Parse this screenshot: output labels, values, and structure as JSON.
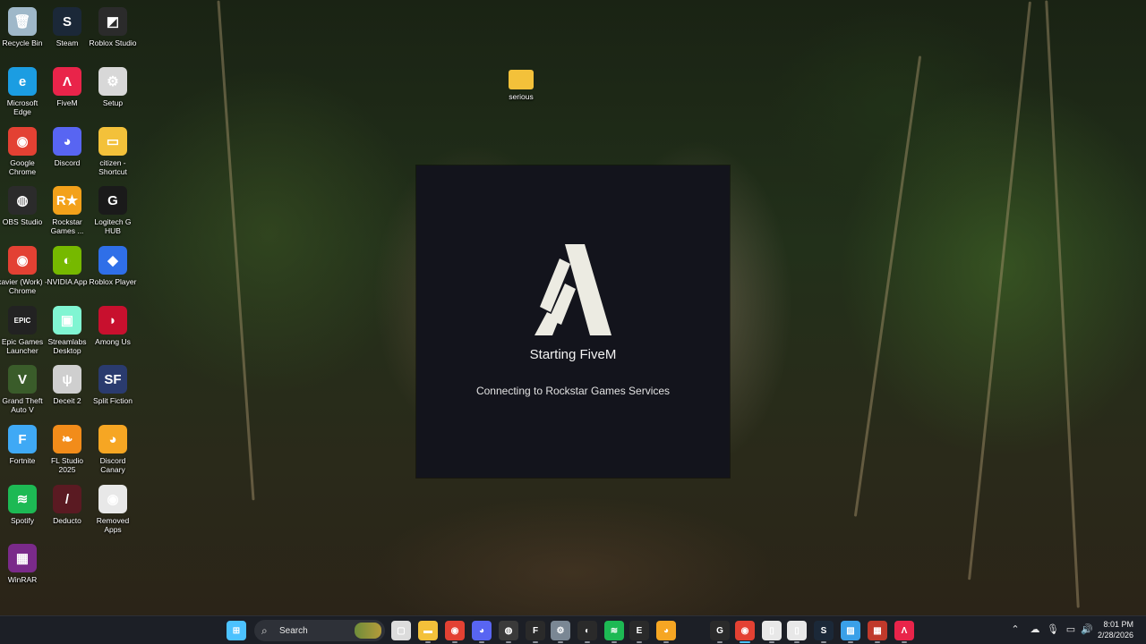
{
  "desktop_icons": [
    {
      "label": "Recycle Bin",
      "icon": "recycle-bin-icon",
      "color": "#9fb8c9",
      "glyph": "🗑",
      "shortcut": false
    },
    {
      "label": "Steam",
      "icon": "steam-icon",
      "color": "#1b2838",
      "glyph": "S",
      "shortcut": true
    },
    {
      "label": "Roblox Studio",
      "icon": "roblox-studio-icon",
      "color": "#2b2b2b",
      "glyph": "◩",
      "shortcut": true
    },
    {
      "label": "Microsoft Edge",
      "icon": "edge-icon",
      "color": "#1b9de2",
      "glyph": "e",
      "shortcut": true
    },
    {
      "label": "FiveM",
      "icon": "fivem-icon",
      "color": "#e9244a",
      "glyph": "Λ",
      "shortcut": true
    },
    {
      "label": "Setup",
      "icon": "setup-icon",
      "color": "#d8d8d8",
      "glyph": "⚙",
      "shortcut": true
    },
    {
      "label": "Google Chrome",
      "icon": "chrome-icon",
      "color": "#e34133",
      "glyph": "◉",
      "shortcut": true
    },
    {
      "label": "Discord",
      "icon": "discord-icon",
      "color": "#5865f2",
      "glyph": "◕",
      "shortcut": true
    },
    {
      "label": "citizen - Shortcut",
      "icon": "folder-icon",
      "color": "#f3c13a",
      "glyph": "▭",
      "shortcut": true
    },
    {
      "label": "OBS Studio",
      "icon": "obs-icon",
      "color": "#2b2b2b",
      "glyph": "◍",
      "shortcut": true
    },
    {
      "label": "Rockstar Games ...",
      "icon": "rockstar-icon",
      "color": "#f3a11a",
      "glyph": "R★",
      "shortcut": true
    },
    {
      "label": "Logitech G HUB",
      "icon": "logitech-icon",
      "color": "#1a1a1a",
      "glyph": "G",
      "shortcut": true
    },
    {
      "label": "xavier (Work) - Chrome",
      "icon": "chrome-profile-icon",
      "color": "#e34133",
      "glyph": "◉",
      "shortcut": true
    },
    {
      "label": "NVIDIA App",
      "icon": "nvidia-icon",
      "color": "#76b900",
      "glyph": "◐",
      "shortcut": true
    },
    {
      "label": "Roblox Player",
      "icon": "roblox-player-icon",
      "color": "#2f6fe8",
      "glyph": "◆",
      "shortcut": true
    },
    {
      "label": "Epic Games Launcher",
      "icon": "epic-games-icon",
      "color": "#222222",
      "glyph": "EPIC",
      "shortcut": true
    },
    {
      "label": "Streamlabs Desktop",
      "icon": "streamlabs-icon",
      "color": "#80f5d2",
      "glyph": "▣",
      "shortcut": true
    },
    {
      "label": "Among Us",
      "icon": "among-us-icon",
      "color": "#c8102e",
      "glyph": "◗",
      "shortcut": true
    },
    {
      "label": "Grand Theft Auto V",
      "icon": "gta-v-icon",
      "color": "#3a5c2a",
      "glyph": "V",
      "shortcut": true
    },
    {
      "label": "Deceit 2",
      "icon": "deceit-2-icon",
      "color": "#cfcfcf",
      "glyph": "ψ",
      "shortcut": true
    },
    {
      "label": "Split Fiction",
      "icon": "split-fiction-icon",
      "color": "#2a3b6e",
      "glyph": "SF",
      "shortcut": true
    },
    {
      "label": "Fortnite",
      "icon": "fortnite-icon",
      "color": "#3fa9f5",
      "glyph": "F",
      "shortcut": true
    },
    {
      "label": "FL Studio 2025",
      "icon": "fl-studio-icon",
      "color": "#f28c1a",
      "glyph": "❧",
      "shortcut": true
    },
    {
      "label": "Discord Canary",
      "icon": "discord-canary-icon",
      "color": "#f6a623",
      "glyph": "◕",
      "shortcut": true
    },
    {
      "label": "Spotify",
      "icon": "spotify-icon",
      "color": "#1db954",
      "glyph": "≋",
      "shortcut": true
    },
    {
      "label": "Deducto",
      "icon": "deducto-icon",
      "color": "#5a1a22",
      "glyph": "/",
      "shortcut": true
    },
    {
      "label": "Removed Apps",
      "icon": "removed-apps-icon",
      "color": "#e8e8e8",
      "glyph": "◉",
      "shortcut": true
    },
    {
      "label": "WinRAR",
      "icon": "winrar-icon",
      "color": "#7a2a8a",
      "glyph": "▦",
      "shortcut": true
    }
  ],
  "floating_folder": {
    "label": "serious",
    "icon": "folder-icon"
  },
  "launcher": {
    "title": "Starting FiveM",
    "status": "Connecting to Rockstar Games Services",
    "logo": "fivem-logo-icon"
  },
  "taskbar": {
    "search_placeholder": "Search",
    "apps": [
      {
        "name": "start-button",
        "icon": "windows-start-icon",
        "color": "#4cc2ff",
        "glyph": "⊞"
      },
      {
        "name": "task-view",
        "icon": "task-view-icon",
        "color": "#dcdcdc",
        "glyph": "▢"
      },
      {
        "name": "file-explorer",
        "icon": "folder-icon",
        "color": "#f3c13a",
        "glyph": "▬"
      },
      {
        "name": "chrome",
        "icon": "chrome-icon",
        "color": "#e34133",
        "glyph": "◉"
      },
      {
        "name": "discord",
        "icon": "discord-icon",
        "color": "#5865f2",
        "glyph": "◕"
      },
      {
        "name": "obs",
        "icon": "obs-icon",
        "color": "#3a3a3a",
        "glyph": "◍"
      },
      {
        "name": "fivem",
        "icon": "fivem-icon",
        "color": "#2a2a2a",
        "glyph": "F"
      },
      {
        "name": "settings",
        "icon": "gear-icon",
        "color": "#7a8794",
        "glyph": "⚙"
      },
      {
        "name": "nvidia",
        "icon": "nvidia-icon",
        "color": "#2a2a2a",
        "glyph": "◐"
      },
      {
        "name": "spotify",
        "icon": "spotify-icon",
        "color": "#1db954",
        "glyph": "≋"
      },
      {
        "name": "epic-games",
        "icon": "epic-games-icon",
        "color": "#2a2a2a",
        "glyph": "E"
      },
      {
        "name": "discord-canary",
        "icon": "discord-canary-icon",
        "color": "#f6a623",
        "glyph": "◕"
      },
      {
        "name": "logitech",
        "icon": "logitech-icon",
        "color": "#2a2a2a",
        "glyph": "G"
      },
      {
        "name": "chrome-profile",
        "icon": "chrome-profile-icon",
        "color": "#e34133",
        "glyph": "◉"
      },
      {
        "name": "document-1",
        "icon": "document-icon",
        "color": "#e8e8e8",
        "glyph": "▯"
      },
      {
        "name": "document-2",
        "icon": "document-icon",
        "color": "#e8e8e8",
        "glyph": "▯"
      },
      {
        "name": "steam",
        "icon": "steam-icon",
        "color": "#1b2838",
        "glyph": "S"
      },
      {
        "name": "photos",
        "icon": "photos-icon",
        "color": "#3aa0e8",
        "glyph": "▨"
      },
      {
        "name": "rockstar-launcher",
        "icon": "rockstar-icon",
        "color": "#c0392b",
        "glyph": "▦"
      },
      {
        "name": "fivem-launcher",
        "icon": "fivem-icon",
        "color": "#e9244a",
        "glyph": "Λ"
      }
    ],
    "tray": [
      {
        "name": "show-hidden-icons",
        "glyph": "⌃"
      },
      {
        "name": "onedrive",
        "glyph": "☁"
      },
      {
        "name": "microphone",
        "glyph": "🎙"
      },
      {
        "name": "network",
        "glyph": "▭"
      },
      {
        "name": "volume",
        "glyph": "🔊"
      },
      {
        "name": "battery",
        "glyph": "▮"
      }
    ],
    "time": "8:01 PM",
    "date": "2/28/2026"
  }
}
